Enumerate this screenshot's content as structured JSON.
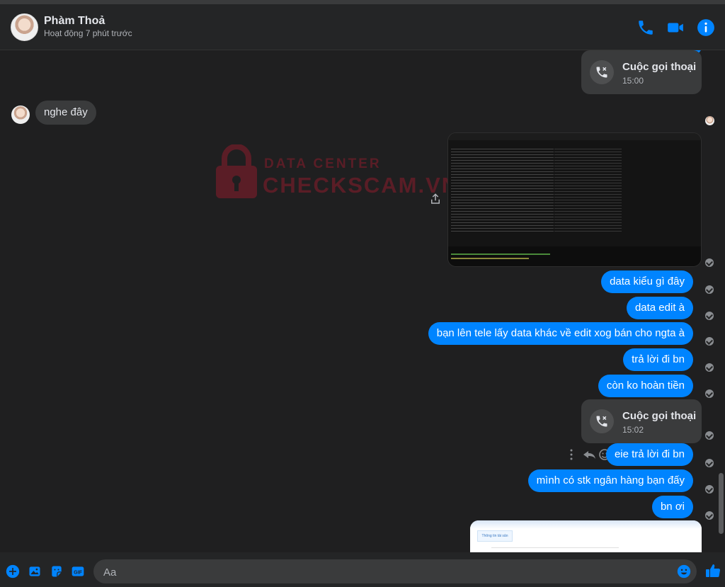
{
  "header": {
    "name": "Phàm Thoả",
    "status": "Hoạt động 7 phút trước"
  },
  "watermark": {
    "top": "DATA CENTER",
    "main": "CHECKSCAM.VN"
  },
  "calls": [
    {
      "title": "Cuộc gọi thoại",
      "time": "15:00"
    },
    {
      "title": "Cuộc gọi thoại",
      "time": "15:02"
    }
  ],
  "messages_in": [
    {
      "text": "nghe đây"
    }
  ],
  "messages_out": [
    {
      "text": "data kiểu gì đây"
    },
    {
      "text": "data edit à"
    },
    {
      "text": "bạn lên tele lấy data khác về edit xog bán cho ngta à"
    },
    {
      "text": "trả lời đi bn"
    },
    {
      "text": "còn ko hoàn tiền"
    },
    {
      "text": "eie trả lời đi bn"
    },
    {
      "text": "mình có stk ngân hàng bạn đấy"
    },
    {
      "text": "bn ơi"
    }
  ],
  "card_preview": {
    "tab": "Thông tin tài sản"
  },
  "composer": {
    "placeholder": "Aa"
  },
  "colors": {
    "accent": "#0084ff",
    "background": "#1f1f20",
    "bubble_in": "#3a3b3c"
  },
  "icons": {
    "call": "phone-icon",
    "video": "video-camera-icon",
    "info": "info-icon",
    "missed_call": "missed-call-icon",
    "add": "plus-circle-icon",
    "image": "image-icon",
    "sticker": "sticker-icon",
    "gif": "gif-icon",
    "emoji": "emoji-icon",
    "like": "thumbs-up-icon"
  }
}
